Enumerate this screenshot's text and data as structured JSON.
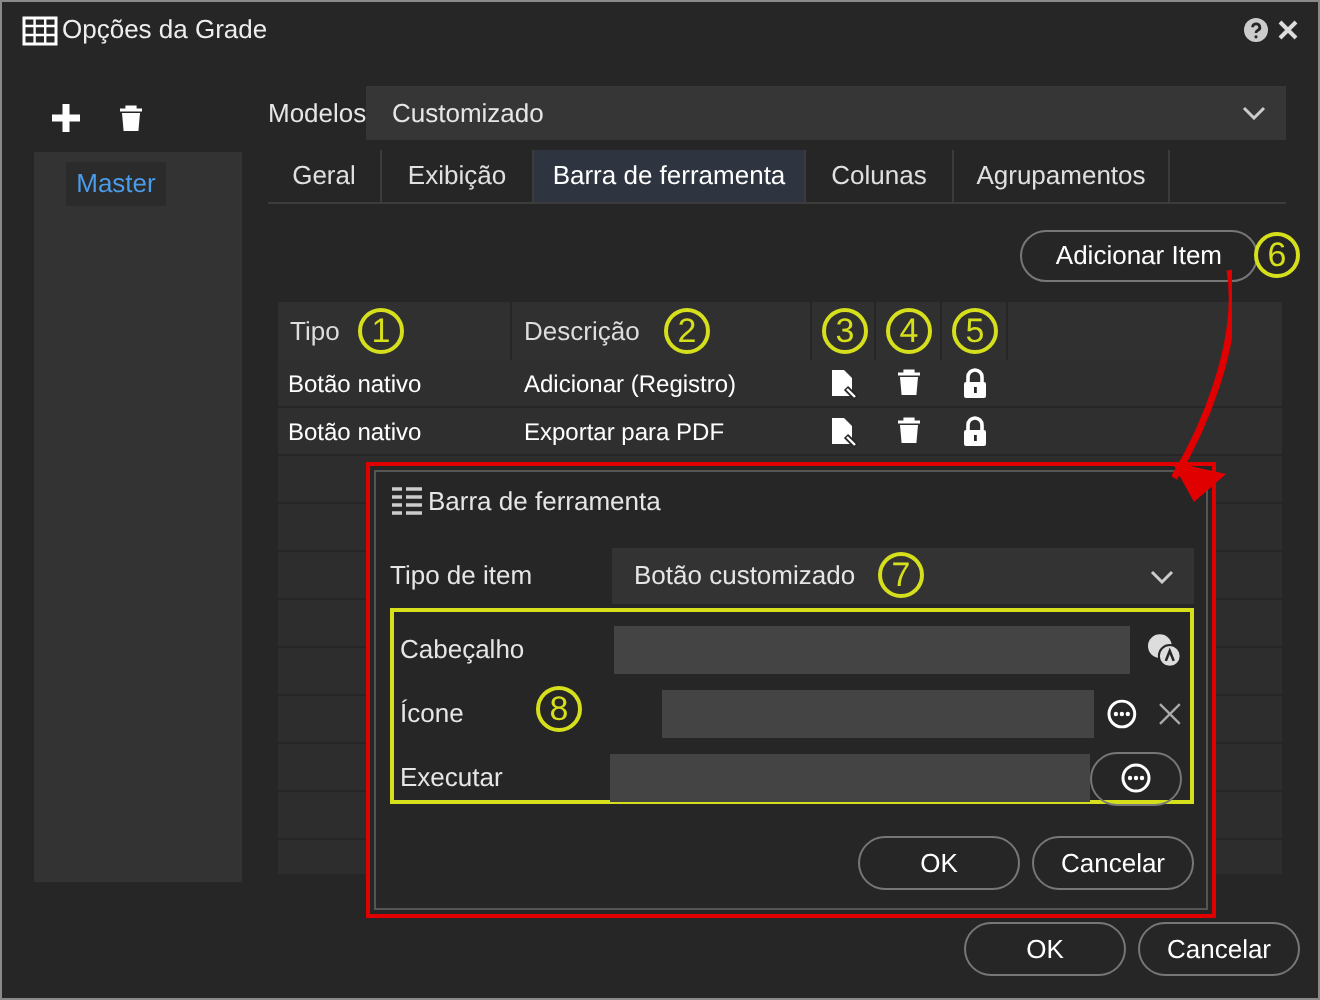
{
  "window": {
    "title": "Opções da Grade"
  },
  "sidebar": {
    "items": [
      {
        "label": "Master",
        "selected": true
      }
    ]
  },
  "models": {
    "label": "Modelos",
    "value": "Customizado"
  },
  "tabs": [
    {
      "label": "Geral",
      "selected": false
    },
    {
      "label": "Exibição",
      "selected": false
    },
    {
      "label": "Barra de ferramenta",
      "selected": true
    },
    {
      "label": "Colunas",
      "selected": false
    },
    {
      "label": "Agrupamentos",
      "selected": false
    }
  ],
  "add_button": {
    "label": "Adicionar Item",
    "annotation": "6"
  },
  "table": {
    "columns": [
      {
        "label": "Tipo",
        "annotation": "1"
      },
      {
        "label": "Descrição",
        "annotation": "2"
      },
      {
        "annotation": "3"
      },
      {
        "annotation": "4"
      },
      {
        "annotation": "5"
      }
    ],
    "rows": [
      {
        "type": "Botão nativo",
        "description": "Adicionar (Registro)"
      },
      {
        "type": "Botão nativo",
        "description": "Exportar para PDF"
      }
    ]
  },
  "dialog": {
    "title": "Barra de ferramenta",
    "item_type": {
      "label": "Tipo de item",
      "value": "Botão customizado",
      "annotation": "7"
    },
    "fields_annotation": "8",
    "fields": [
      {
        "kind": "translate",
        "label": "Cabeçalho"
      },
      {
        "kind": "icon",
        "label": "Ícone"
      },
      {
        "kind": "action",
        "label": "Executar"
      }
    ],
    "buttons": [
      "OK",
      "Cancelar"
    ]
  },
  "buttons": [
    "OK",
    "Cancelar"
  ]
}
